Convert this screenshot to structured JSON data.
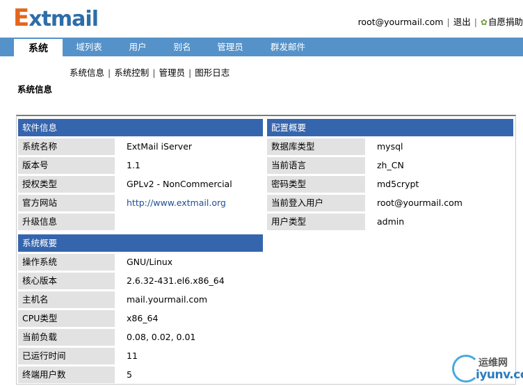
{
  "header": {
    "logo_initial": "E",
    "logo_rest": "xtmail",
    "user_email": "root@yourmail.com",
    "logout_label": "退出",
    "donate_label": "自愿捐助"
  },
  "nav": {
    "tabs": [
      "系统",
      "域列表",
      "用户",
      "别名",
      "管理员",
      "群发邮件"
    ],
    "active": "系统"
  },
  "subnav": {
    "items": [
      "系统信息",
      "系统控制",
      "管理员",
      "图形日志"
    ]
  },
  "page": {
    "title": "系统信息"
  },
  "software": {
    "heading": "软件信息",
    "rows": [
      {
        "label": "系统名称",
        "value": "ExtMail iServer"
      },
      {
        "label": "版本号",
        "value": "1.1"
      },
      {
        "label": "授权类型",
        "value": "GPLv2 - NonCommercial"
      },
      {
        "label": "官方网站",
        "value": "http://www.extmail.org"
      },
      {
        "label": "升级信息",
        "value": ""
      }
    ]
  },
  "config": {
    "heading": "配置概要",
    "rows": [
      {
        "label": "数据库类型",
        "value": "mysql"
      },
      {
        "label": "当前语言",
        "value": "zh_CN"
      },
      {
        "label": "密码类型",
        "value": "md5crypt"
      },
      {
        "label": "当前登入用户",
        "value": "root@yourmail.com"
      },
      {
        "label": "用户类型",
        "value": "admin"
      }
    ]
  },
  "system": {
    "heading": "系统概要",
    "rows": [
      {
        "label": "操作系统",
        "value": "GNU/Linux"
      },
      {
        "label": "核心版本",
        "value": "2.6.32-431.el6.x86_64"
      },
      {
        "label": "主机名",
        "value": "mail.yourmail.com"
      },
      {
        "label": "CPU类型",
        "value": "x86_64"
      },
      {
        "label": "当前负载",
        "value": "0.08, 0.02, 0.01"
      },
      {
        "label": "已运行时间",
        "value": "11"
      },
      {
        "label": "终端用户数",
        "value": "5"
      }
    ]
  },
  "watermark": {
    "line1": "运维网",
    "line2": "iyunv.com"
  },
  "colors": {
    "nav_bar": "#5592c9",
    "section_head": "#3565ad",
    "label_bg": "#e2e2e2",
    "link": "#1f4e93",
    "logo_orange": "#e3661e",
    "logo_blue": "#2d6da8"
  }
}
